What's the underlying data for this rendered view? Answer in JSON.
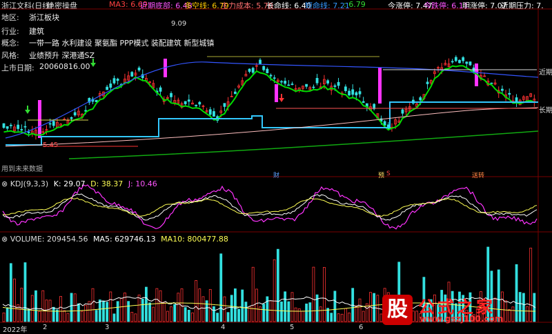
{
  "topbar": {
    "title": "浙江文科(日线)",
    "mode": "绝密操盘",
    "items": [
      {
        "label": "MA3: 6.69",
        "color": "#ff4040"
      },
      {
        "label": "近期底部: 6.48",
        "color": "#ff55ff"
      },
      {
        "label": "多空线: 6.79",
        "color": "#ffcc00"
      },
      {
        "label": "主力成本: 5.78",
        "color": "#ff7070"
      },
      {
        "label": "长命线: 6.40",
        "color": "#ffffff"
      },
      {
        "label": "短命线: 7.21",
        "color": "#3399ff"
      },
      {
        "label": ": 6.79",
        "color": "#33dd33"
      },
      {
        "label": "今涨停: 7.47",
        "color": "#ffffff"
      },
      {
        "label": "今跌停: 6.11",
        "color": "#ff55ff"
      },
      {
        "label": "明涨停: 7.07",
        "color": "#ffffff"
      },
      {
        "label": "近期压力: 7.",
        "color": "#ffffff"
      }
    ]
  },
  "info": {
    "region_label": "地区:",
    "region_value": "浙江板块",
    "industry_label": "行业:",
    "industry_value": "建筑",
    "concept_label": "概念:",
    "concept_value": "一带一路 水利建设 聚氨酯 PPP模式 装配建筑 新型城镇",
    "style_label": "风格:",
    "style_value": "业绩预升 深港通SZ",
    "listing_label": "上市日期:",
    "listing_value": "20060816.00"
  },
  "price_labels": {
    "high": "9.09",
    "low": "5.45",
    "near_period": "近期",
    "long_period": "长期",
    "future_data": "用到未来数据"
  },
  "markers": {
    "cai": "财",
    "yu": "预",
    "s": "S",
    "hui": "送转"
  },
  "kdj": {
    "label": "KDJ(9,3,3)",
    "k": "K: 29.07",
    "d": "D: 38.37",
    "j": "J: 10.46"
  },
  "volume": {
    "label": "VOLUME: 209454.56",
    "ma5": "MA5: 629746.13",
    "ma10": "MA10: 800477.88"
  },
  "xaxis": {
    "labels": [
      "2022年",
      "2",
      "3",
      "4",
      "5",
      "6"
    ]
  },
  "watermark": {
    "icon_char": "股",
    "text": "公式之家",
    "url": "www.gszj100.com"
  },
  "colors": {
    "up": "#ff3333",
    "down": "#33e0e0",
    "magenta": "#ff33ff",
    "green": "#00dd00",
    "blue": "#3399ff"
  }
}
